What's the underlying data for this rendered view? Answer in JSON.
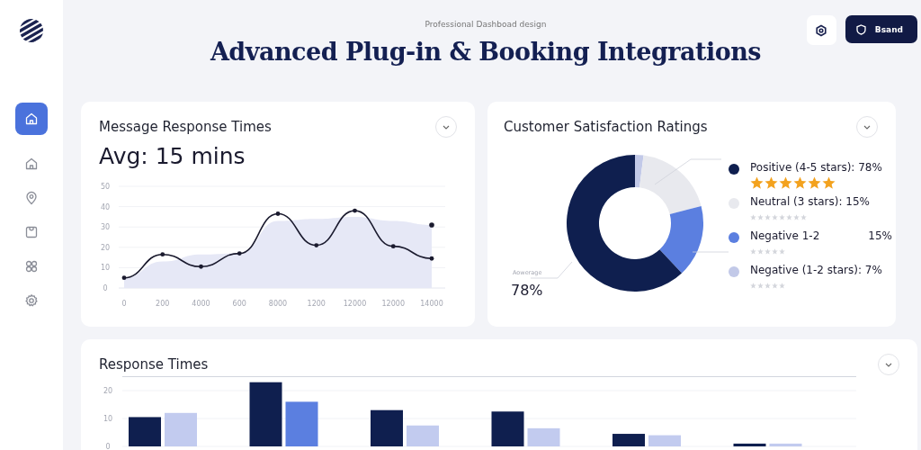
{
  "sidebar": {
    "items": [
      {
        "selected": true
      },
      {
        "selected": false
      },
      {
        "selected": false
      },
      {
        "selected": false
      },
      {
        "selected": false
      },
      {
        "selected": false
      }
    ]
  },
  "header": {
    "subtitle": "Professional Dashboad design",
    "title": "Advanced Plug-in & Booking Integrations",
    "brand_button": "Bsand"
  },
  "response_card": {
    "title": "Message Response Times",
    "average": "Avg: 15 mins",
    "chart_data": {
      "type": "line",
      "categories": [
        "0",
        "200",
        "4000",
        "600",
        "8000",
        "1200",
        "12000",
        "12000",
        "14000"
      ],
      "yticks": [
        0,
        10,
        20,
        30,
        40,
        50
      ],
      "ylim": [
        0,
        50
      ],
      "grid": true,
      "series": [
        {
          "color": "#1a1a2e",
          "values": [
            5,
            16.5,
            10.5,
            17,
            36.5,
            21,
            38,
            20.5,
            14.5
          ]
        },
        {
          "type": "area",
          "color": "#e6e8f6",
          "values": [
            5,
            13,
            16.5,
            17,
            33,
            34,
            35,
            33,
            31
          ]
        }
      ]
    }
  },
  "satisfaction_card": {
    "title": "Customer Satisfaction Ratings",
    "annotation_label": "Aowerage",
    "annotation_value": "78%",
    "legend": [
      {
        "label": "Positive (4-5 stars): 78%",
        "color": "#0f1f4f",
        "star_row": [
          {
            "filled": true
          },
          {
            "filled": true
          },
          {
            "filled": true
          },
          {
            "filled": true
          },
          {
            "filled": true
          },
          {
            "filled": true
          }
        ]
      },
      {
        "label": "Neutral (3 stars): 15%",
        "color": "#e8e9ee",
        "star_row": [
          {
            "filled": false
          },
          {
            "filled": false
          },
          {
            "filled": false
          },
          {
            "filled": false
          },
          {
            "filled": false
          },
          {
            "filled": false
          },
          {
            "filled": false
          },
          {
            "filled": false
          }
        ]
      },
      {
        "label": "Negative 1-2",
        "value": "15%",
        "color": "#5b7fe0",
        "star_row": [
          {
            "filled": false
          },
          {
            "filled": false
          },
          {
            "filled": false
          },
          {
            "filled": false
          },
          {
            "filled": false
          }
        ]
      },
      {
        "label": "Negative (1-2 stars): 7%",
        "color": "#c2c9e8",
        "star_row": [
          {
            "filled": false
          },
          {
            "filled": false
          },
          {
            "filled": false
          },
          {
            "filled": false
          },
          {
            "filled": false
          }
        ]
      }
    ]
  },
  "bar_card": {
    "title": "Response Times",
    "chart_data": {
      "type": "bar",
      "yticks": [
        0,
        10,
        20
      ],
      "ylim": [
        0,
        25
      ],
      "grid": true,
      "series": [
        {
          "color": "#0f1f4f",
          "values": [
            10.5,
            23,
            13,
            12.5,
            4.5,
            1
          ]
        },
        {
          "color": "#c2cbef",
          "values": [
            12,
            null,
            7.5,
            6.5,
            4,
            1
          ]
        },
        {
          "color": "#5b7fe0",
          "values": [
            null,
            16,
            null,
            null,
            null,
            null
          ]
        }
      ]
    }
  }
}
